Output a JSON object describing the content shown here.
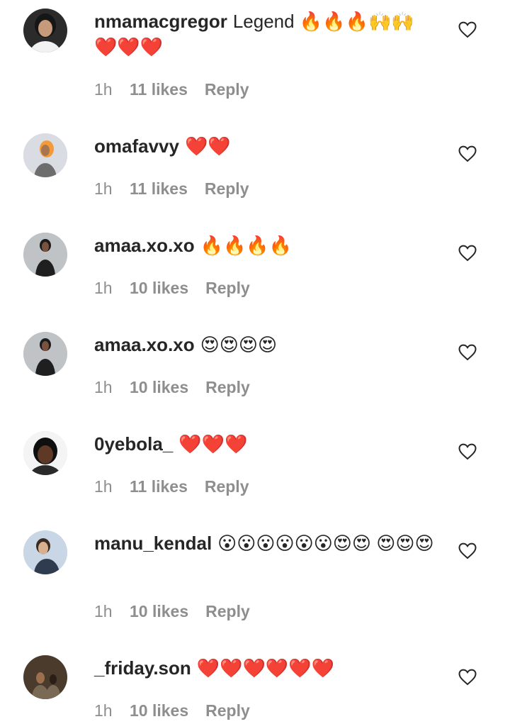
{
  "comments": [
    {
      "username": "nmamacgregor",
      "text": "Legend 🔥🔥🔥🙌🙌 ❤️❤️❤️",
      "time": "1h",
      "likes": "11 likes",
      "reply": "Reply",
      "avatar": {
        "bg": "#2b2b2b",
        "skin": "#c79a7c",
        "hair": "#161616",
        "shirt": "#f2f2f2"
      }
    },
    {
      "username": "omafavvy",
      "text": "❤️❤️",
      "time": "1h",
      "likes": "11 likes",
      "reply": "Reply",
      "avatar": {
        "bg": "#d9dde3",
        "skin": "#a87552",
        "hair": "#f39a3a",
        "shirt": "#6d6d6d"
      }
    },
    {
      "username": "amaa.xo.xo",
      "text": "🔥🔥🔥🔥",
      "time": "1h",
      "likes": "10 likes",
      "reply": "Reply",
      "avatar": {
        "bg": "#bfc3c6",
        "skin": "#7a523d",
        "hair": "#1b1b1b",
        "shirt": "#1f1f1f"
      }
    },
    {
      "username": "amaa.xo.xo",
      "text": "😍😍😍😍",
      "time": "1h",
      "likes": "10 likes",
      "reply": "Reply",
      "avatar": {
        "bg": "#bfc3c6",
        "skin": "#7a523d",
        "hair": "#1b1b1b",
        "shirt": "#1f1f1f"
      }
    },
    {
      "username": "0yebola_",
      "text": "❤️❤️❤️",
      "time": "1h",
      "likes": "11 likes",
      "reply": "Reply",
      "avatar": {
        "bg": "#f4f4f4",
        "skin": "#5e3a26",
        "hair": "#0f0f0f",
        "shirt": "#2a2a2a"
      }
    },
    {
      "username": "manu_kendal",
      "text": "😮😮😮😮😮😮😍😍 😍😍😍",
      "time": "1h",
      "likes": "10 likes",
      "reply": "Reply",
      "avatar": {
        "bg": "#c9d6e6",
        "skin": "#d8b08f",
        "hair": "#3a2a22",
        "shirt": "#2f3c4f"
      }
    },
    {
      "username": "_friday.son",
      "text": "❤️❤️❤️❤️❤️❤️",
      "time": "1h",
      "likes": "10 likes",
      "reply": "Reply",
      "avatar": {
        "bg": "#4a3b2c",
        "skin": "#9c6f4f",
        "hair": "#2a1e16",
        "shirt": "#7a6a55"
      }
    }
  ]
}
